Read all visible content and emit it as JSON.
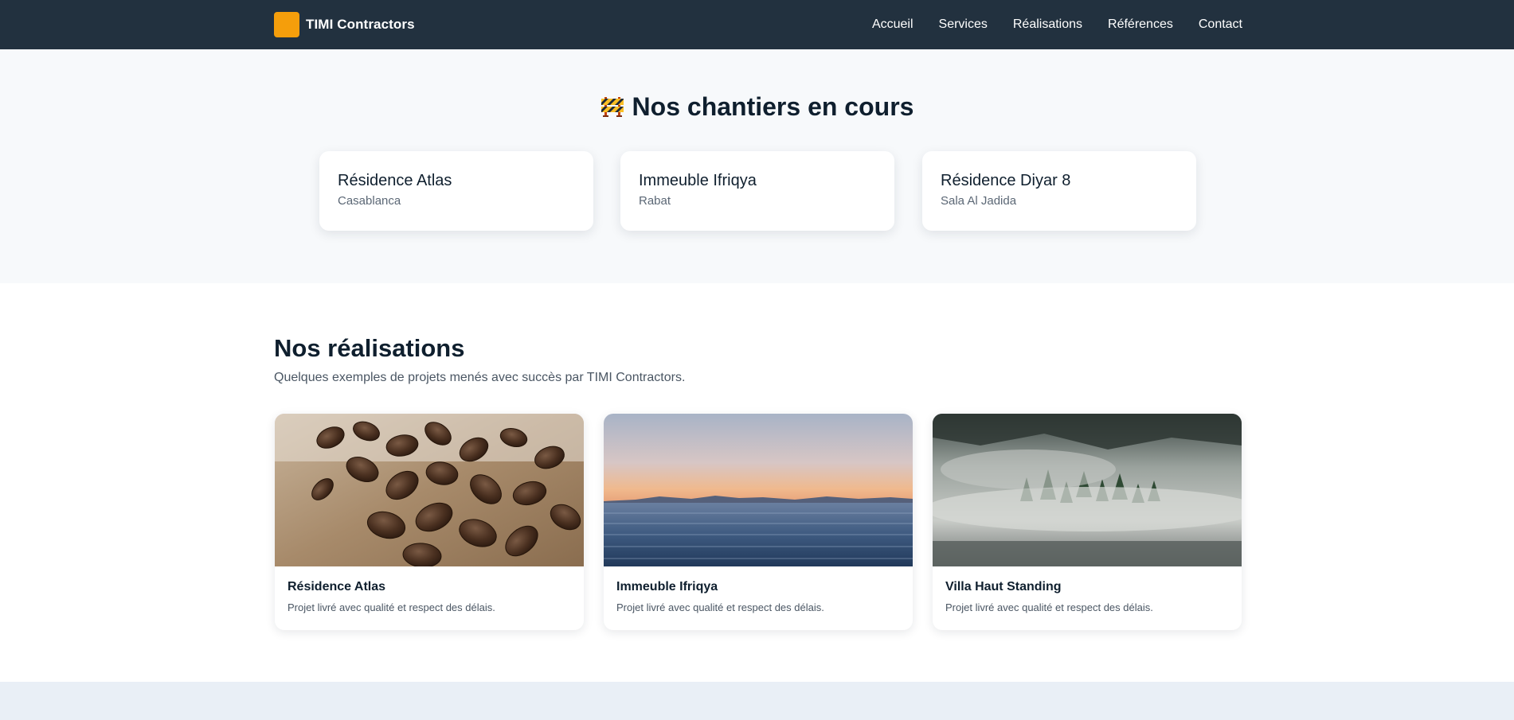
{
  "header": {
    "brand": "TIMI Contractors",
    "brand_color": "#f59e0b",
    "nav": [
      "Accueil",
      "Services",
      "Réalisations",
      "Références",
      "Contact"
    ]
  },
  "ongoing": {
    "icon": "construction-barrier-icon",
    "title": "Nos chantiers en cours",
    "sites": [
      {
        "name": "Résidence Atlas",
        "city": "Casablanca"
      },
      {
        "name": "Immeuble Ifriqya",
        "city": "Rabat"
      },
      {
        "name": "Résidence Diyar 8",
        "city": "Sala Al Jadida"
      }
    ]
  },
  "realisations": {
    "title": "Nos réalisations",
    "subtitle": "Quelques exemples de projets menés avec succès par TIMI Contractors.",
    "projects": [
      {
        "name": "Résidence Atlas",
        "desc": "Projet livré avec qualité et respect des délais.",
        "image": "coffee-beans-photo"
      },
      {
        "name": "Immeuble Ifriqya",
        "desc": "Projet livré avec qualité et respect des délais.",
        "image": "sea-sunset-photo"
      },
      {
        "name": "Villa Haut Standing",
        "desc": "Projet livré avec qualité et respect des délais.",
        "image": "misty-forest-photo"
      }
    ]
  }
}
